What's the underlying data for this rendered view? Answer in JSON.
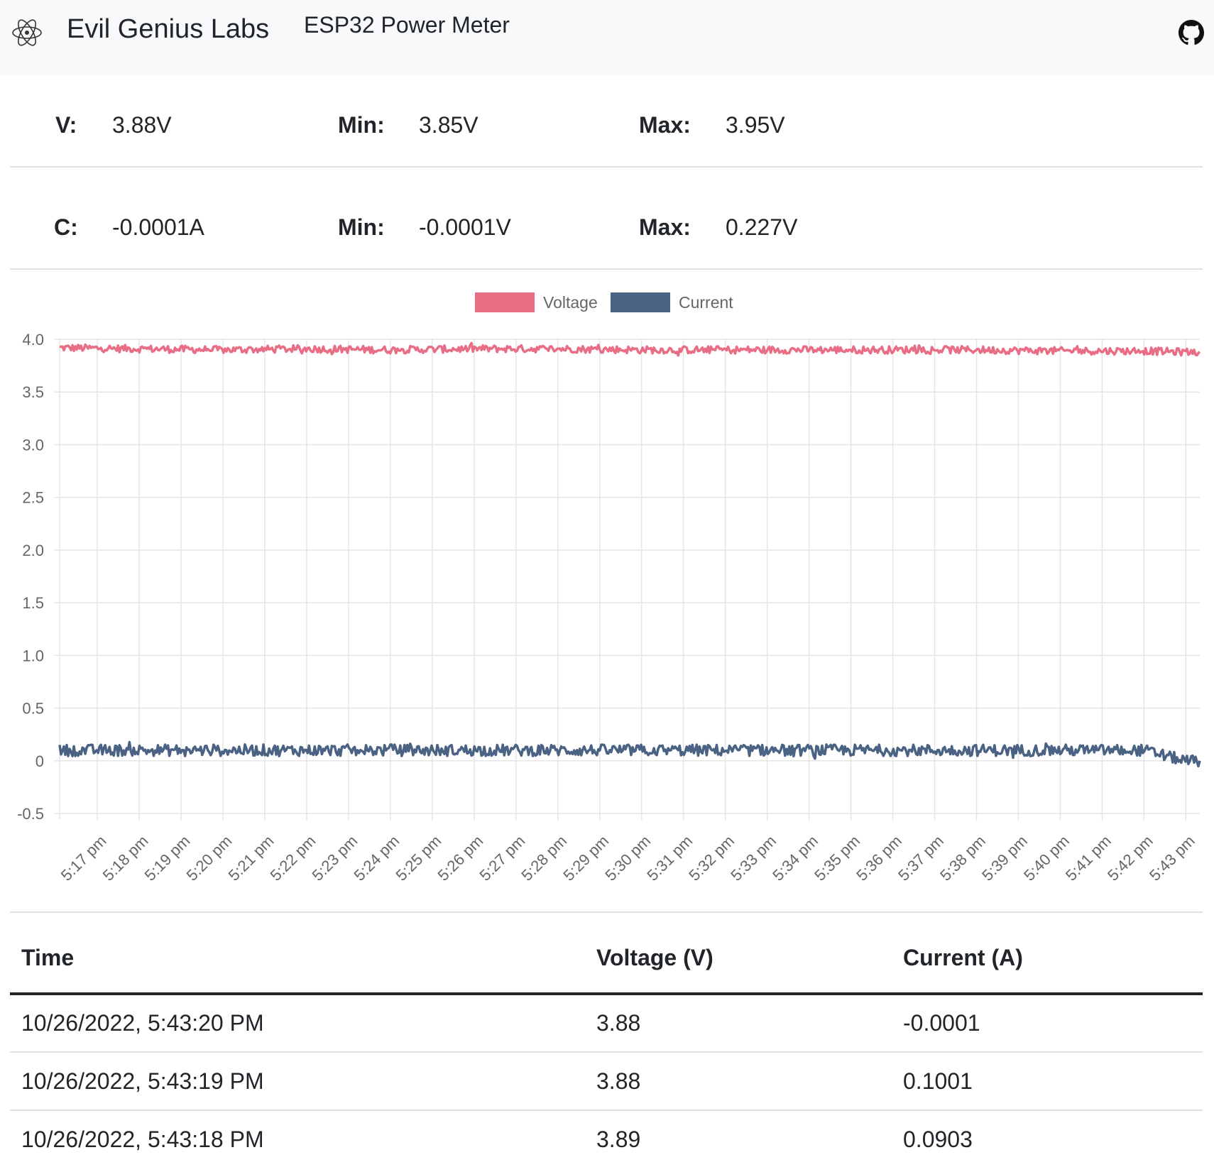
{
  "navbar": {
    "logo_icon": "atom-icon",
    "brand": "Evil Genius Labs",
    "title": "ESP32 Power Meter",
    "github_icon": "github-icon"
  },
  "stats": {
    "voltage": {
      "label": "V:",
      "value": "3.88V",
      "min_label": "Min:",
      "min_value": "3.85V",
      "max_label": "Max:",
      "max_value": "3.95V"
    },
    "current": {
      "label": "C:",
      "value": "-0.0001A",
      "min_label": "Min:",
      "min_value": "-0.0001V",
      "max_label": "Max:",
      "max_value": "0.227V"
    }
  },
  "chart_data": {
    "type": "line",
    "title": "",
    "xlabel": "",
    "ylabel": "",
    "ylim": [
      -0.5,
      4.0
    ],
    "y_ticks": [
      "4.0",
      "3.5",
      "3.0",
      "2.5",
      "2.0",
      "1.5",
      "1.0",
      "0.5",
      "0",
      "-0.5"
    ],
    "y_tick_values": [
      4.0,
      3.5,
      3.0,
      2.5,
      2.0,
      1.5,
      1.0,
      0.5,
      0,
      -0.5
    ],
    "x_ticks": [
      "5:17 pm",
      "5:18 pm",
      "5:19 pm",
      "5:20 pm",
      "5:21 pm",
      "5:22 pm",
      "5:23 pm",
      "5:24 pm",
      "5:25 pm",
      "5:26 pm",
      "5:27 pm",
      "5:28 pm",
      "5:29 pm",
      "5:30 pm",
      "5:31 pm",
      "5:32 pm",
      "5:33 pm",
      "5:34 pm",
      "5:35 pm",
      "5:36 pm",
      "5:37 pm",
      "5:38 pm",
      "5:39 pm",
      "5:40 pm",
      "5:41 pm",
      "5:42 pm",
      "5:43 pm"
    ],
    "x_range": [
      "5:16:06 pm",
      "5:43:20 pm"
    ],
    "grid": true,
    "legend_position": "top",
    "series": [
      {
        "name": "Voltage",
        "color": "#ea6d86",
        "x": [
          "5:16 pm",
          "5:18 pm",
          "5:20 pm",
          "5:22 pm",
          "5:24 pm",
          "5:26 pm",
          "5:28 pm",
          "5:30 pm",
          "5:32 pm",
          "5:34 pm",
          "5:36 pm",
          "5:38 pm",
          "5:40 pm",
          "5:42 pm",
          "5:43 pm"
        ],
        "values": [
          3.92,
          3.91,
          3.9,
          3.91,
          3.9,
          3.91,
          3.91,
          3.9,
          3.9,
          3.9,
          3.9,
          3.9,
          3.89,
          3.89,
          3.88
        ]
      },
      {
        "name": "Current",
        "color": "#4a6283",
        "x": [
          "5:16 pm",
          "5:18 pm",
          "5:20 pm",
          "5:22 pm",
          "5:24 pm",
          "5:26 pm",
          "5:28 pm",
          "5:30 pm",
          "5:32 pm",
          "5:34 pm",
          "5:36 pm",
          "5:38 pm",
          "5:40 pm",
          "5:42 pm",
          "5:43 pm"
        ],
        "values": [
          0.1,
          0.1,
          0.1,
          0.1,
          0.1,
          0.1,
          0.1,
          0.1,
          0.1,
          0.1,
          0.1,
          0.1,
          0.1,
          0.1,
          -0.0001
        ]
      }
    ]
  },
  "table": {
    "headers": [
      "Time",
      "Voltage (V)",
      "Current (A)"
    ],
    "rows": [
      [
        "10/26/2022, 5:43:20 PM",
        "3.88",
        "-0.0001"
      ],
      [
        "10/26/2022, 5:43:19 PM",
        "3.88",
        "0.1001"
      ],
      [
        "10/26/2022, 5:43:18 PM",
        "3.89",
        "0.0903"
      ]
    ]
  }
}
